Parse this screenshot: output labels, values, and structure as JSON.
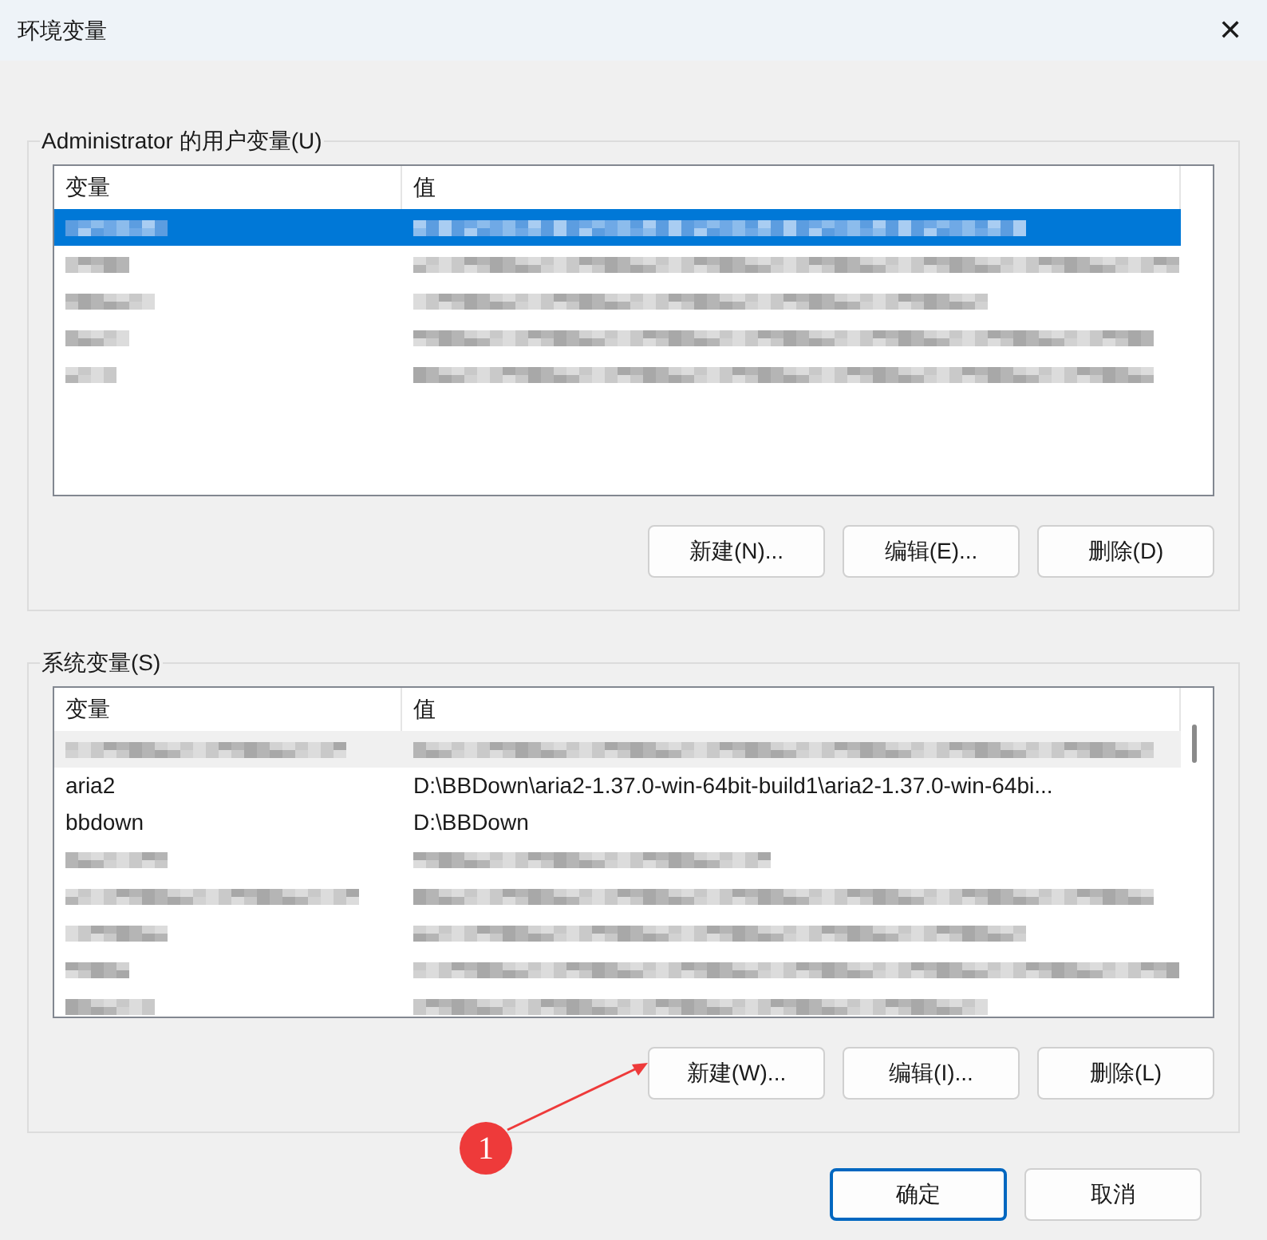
{
  "window": {
    "title": "环境变量",
    "close": "✕"
  },
  "user_vars": {
    "legend": "Administrator 的用户变量(U)",
    "focused": true,
    "columns": [
      "变量",
      "值"
    ],
    "rows": [
      {
        "kind": "blurred",
        "selected": true
      },
      {
        "kind": "blurred",
        "selected": false
      },
      {
        "kind": "blurred",
        "selected": false
      },
      {
        "kind": "blurred",
        "selected": false
      },
      {
        "kind": "blurred",
        "selected": false
      }
    ],
    "buttons": [
      "新建(N)...",
      "编辑(E)...",
      "删除(D)"
    ]
  },
  "system_vars": {
    "legend": "系统变量(S)",
    "focused": false,
    "columns": [
      "变量",
      "值"
    ],
    "rows": [
      {
        "kind": "blurred",
        "selected": true
      },
      {
        "kind": "text",
        "selected": false,
        "name": "aria2",
        "value": "D:\\BBDown\\aria2-1.37.0-win-64bit-build1\\aria2-1.37.0-win-64bi..."
      },
      {
        "kind": "text",
        "selected": false,
        "name": "bbdown",
        "value": "D:\\BBDown"
      },
      {
        "kind": "blurred",
        "selected": false
      },
      {
        "kind": "blurred",
        "selected": false
      },
      {
        "kind": "blurred",
        "selected": false
      },
      {
        "kind": "blurred",
        "selected": false
      },
      {
        "kind": "blurred",
        "selected": false
      }
    ],
    "buttons": [
      "新建(W)...",
      "编辑(I)...",
      "删除(L)"
    ]
  },
  "dialog_buttons": [
    {
      "label": "确定",
      "default": true
    },
    {
      "label": "取消",
      "default": false
    }
  ],
  "annotation": {
    "label": "1"
  }
}
